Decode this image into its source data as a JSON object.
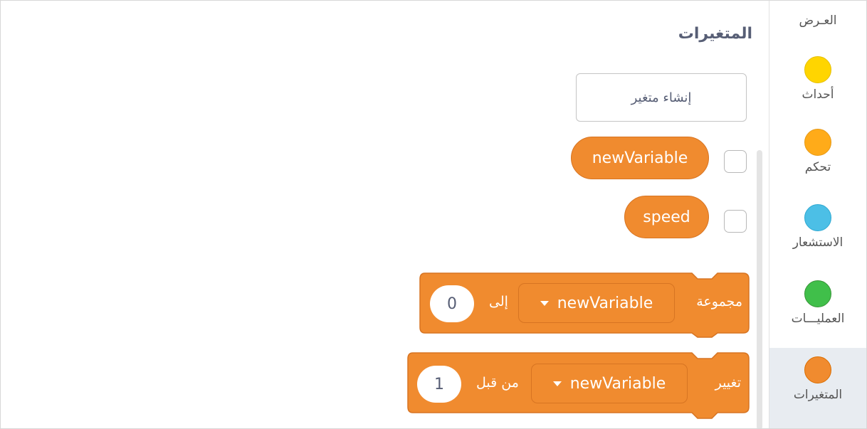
{
  "colors": {
    "variables": "#f08b2f",
    "events": "#ffd500",
    "control": "#ffab19",
    "sensing": "#4cbfe6",
    "operators": "#40bf4a"
  },
  "categories": [
    {
      "label": "العـرض"
    },
    {
      "label": "أحداث",
      "icon": "events-circle-icon"
    },
    {
      "label": "تحكم",
      "icon": "control-circle-icon"
    },
    {
      "label": "الاستشعار",
      "icon": "sensing-circle-icon"
    },
    {
      "label": "العمليـــات",
      "icon": "operators-circle-icon"
    },
    {
      "label": "المتغيرات",
      "icon": "variables-circle-icon",
      "selected": true
    }
  ],
  "palette": {
    "title": "المتغيرات",
    "create_variable_label": "إنشاء متغير"
  },
  "variables": [
    {
      "name": "newVariable",
      "checked": false
    },
    {
      "name": "speed",
      "checked": false
    }
  ],
  "blocks": {
    "set": {
      "label": "مجموعة",
      "variable": "newVariable",
      "to_label": "إلى",
      "value": "0"
    },
    "change": {
      "label": "تغيير",
      "variable": "newVariable",
      "by_label": "من قبل",
      "value": "1"
    }
  }
}
